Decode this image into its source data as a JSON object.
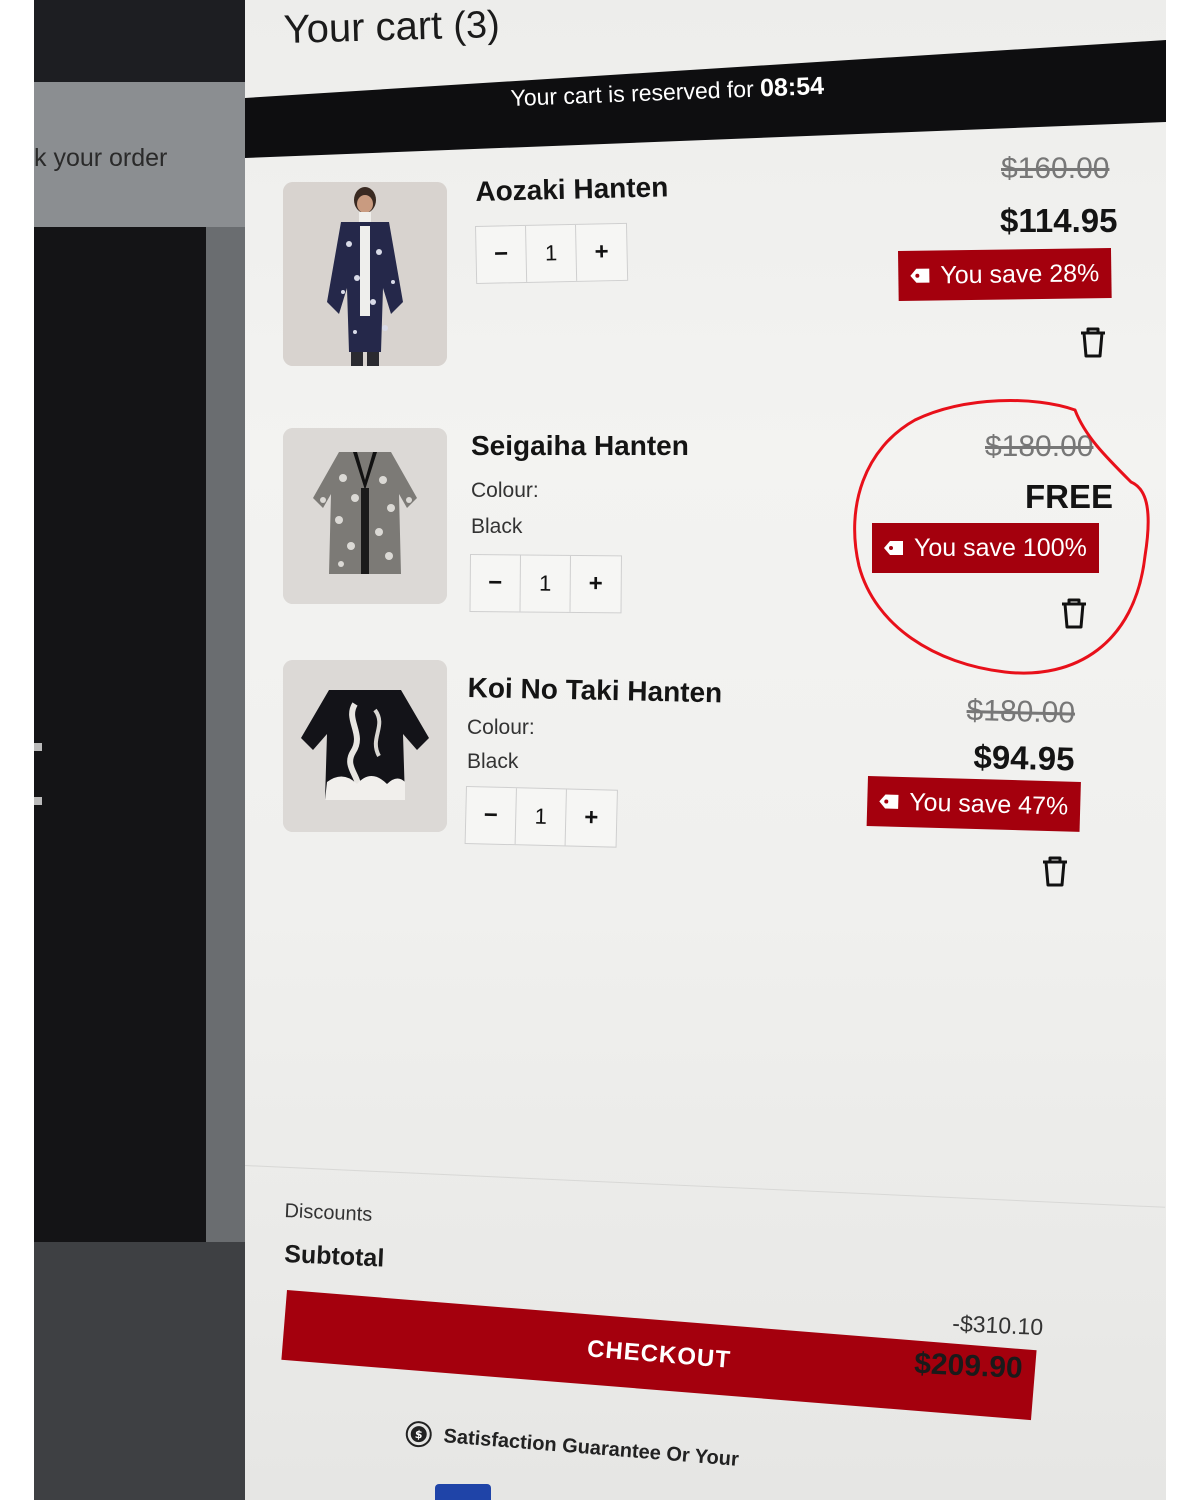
{
  "background_page": {
    "track_order_text": "k your order"
  },
  "cart": {
    "title": "Your cart",
    "count": "(3)",
    "reserve_text": "Your cart is reserved for",
    "reserve_timer": "08:54",
    "items": [
      {
        "name": "Aozaki Hanten",
        "quantity": "1",
        "old_price": "$160.00",
        "new_price": "$114.95",
        "save_badge": "You save 28%"
      },
      {
        "name": "Seigaiha Hanten",
        "colour_label": "Colour:",
        "colour_value": "Black",
        "quantity": "1",
        "old_price": "$180.00",
        "new_price": "FREE",
        "save_badge": "You save 100%"
      },
      {
        "name": "Koi No Taki Hanten",
        "colour_label": "Colour:",
        "colour_value": "Black",
        "quantity": "1",
        "old_price": "$180.00",
        "new_price": "$94.95",
        "save_badge": "You save 47%"
      }
    ],
    "qty_minus": "−",
    "qty_plus": "+"
  },
  "summary": {
    "discounts_label": "Discounts",
    "discounts_value": "-$310.10",
    "subtotal_label": "Subtotal",
    "subtotal_value": "$209.90"
  },
  "checkout_label": "CHECKOUT",
  "guarantee_text": "Satisfaction Guarantee Or Your",
  "colors": {
    "accent_red": "#a4000d",
    "bar_black": "#0e0e10",
    "annotation_red": "#e8101a"
  }
}
